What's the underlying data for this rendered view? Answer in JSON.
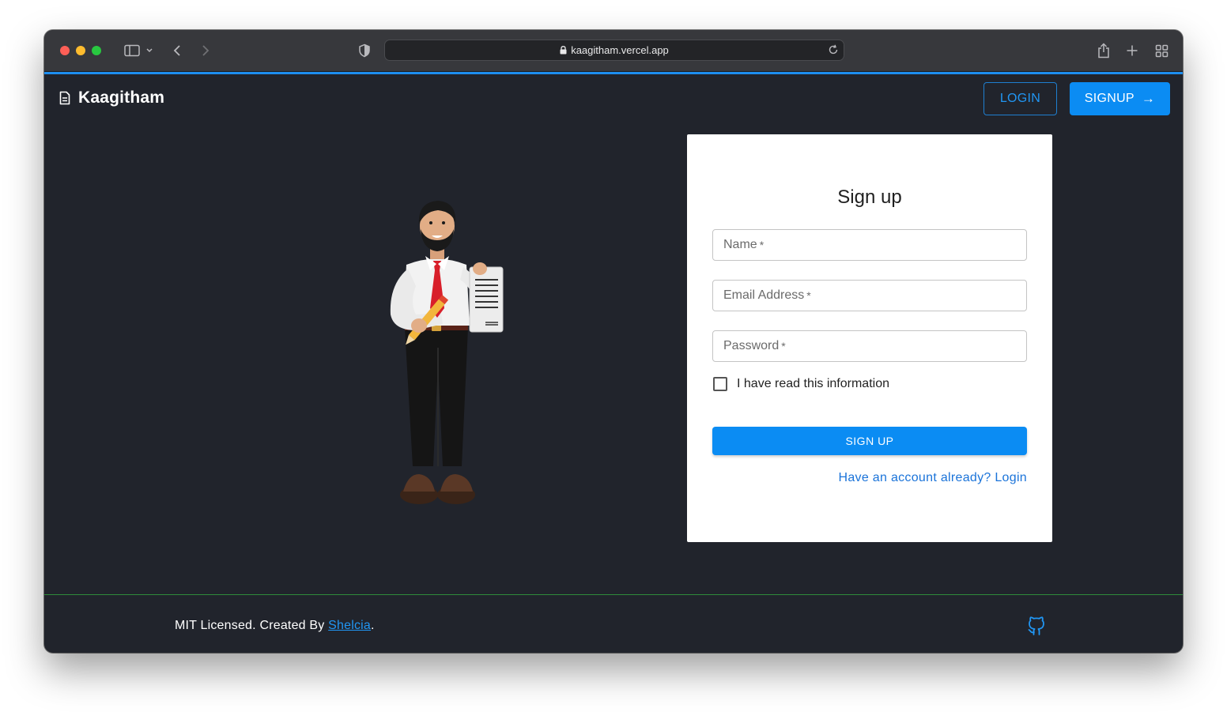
{
  "browser": {
    "url": "kaagitham.vercel.app"
  },
  "header": {
    "brand": "Kaagitham",
    "login_label": "LOGIN",
    "signup_label": "SIGNUP",
    "signup_arrow": "→"
  },
  "form": {
    "title": "Sign up",
    "name_placeholder": "Name",
    "email_placeholder": "Email Address",
    "password_placeholder": "Password",
    "required_mark": "*",
    "checkbox_label": "I have read this information",
    "checkbox_checked": false,
    "submit_label": "SIGN UP",
    "login_link": "Have an account already? Login"
  },
  "footer": {
    "text_prefix": "MIT Licensed. Created By ",
    "author": "Shelcia",
    "text_suffix": "."
  },
  "colors": {
    "page_bg": "#21242c",
    "accent": "#0b8cf3",
    "card_bg": "#ffffff",
    "footer_divider": "#2e8b3a"
  },
  "icons": [
    "document-icon",
    "github-icon",
    "lock-icon",
    "reload-icon",
    "sidebar-icon",
    "back-icon",
    "forward-icon",
    "shield-icon",
    "share-icon",
    "new-tab-icon",
    "tabs-overview-icon"
  ]
}
